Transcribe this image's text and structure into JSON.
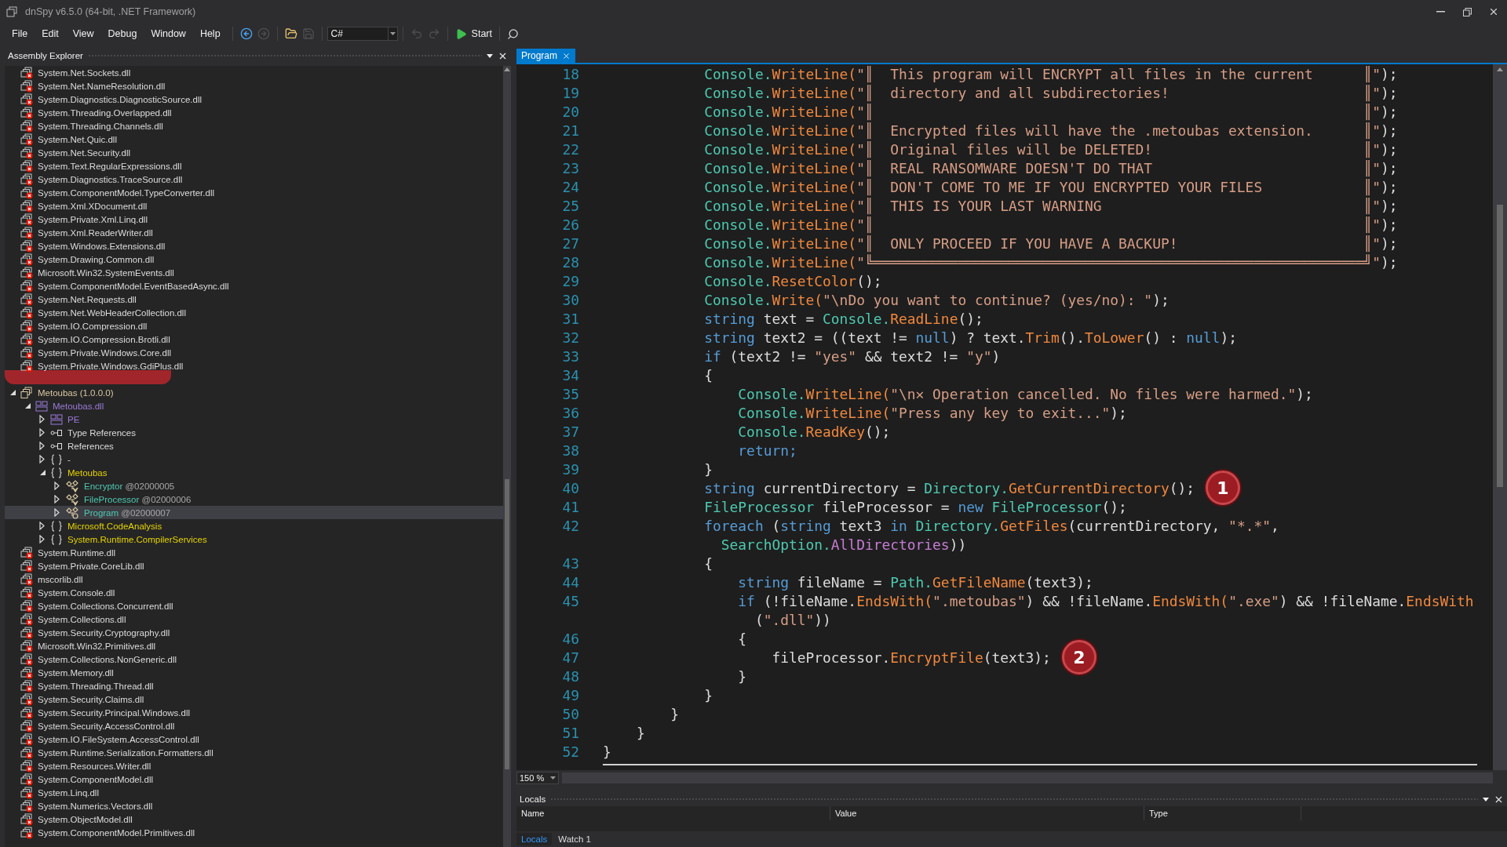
{
  "window": {
    "title": "dnSpy v6.5.0 (64-bit, .NET Framework)"
  },
  "menu": [
    "File",
    "Edit",
    "View",
    "Debug",
    "Window",
    "Help"
  ],
  "toolbar": [
    {
      "kind": "back",
      "disabled": false
    },
    {
      "kind": "forward",
      "disabled": true
    },
    {
      "kind": "open",
      "disabled": false
    },
    {
      "kind": "save",
      "disabled": true
    },
    {
      "kind": "language",
      "value": "C#"
    },
    {
      "kind": "undo",
      "disabled": true
    },
    {
      "kind": "redo",
      "disabled": true
    },
    {
      "kind": "start",
      "label": "Start"
    },
    {
      "kind": "search",
      "disabled": false
    }
  ],
  "assembly_explorer": {
    "title": "Assembly Explorer",
    "items": [
      {
        "label": "System.Net.Sockets.dll",
        "kind": "assembly-error",
        "selected": false
      },
      {
        "label": "System.Net.NameResolution.dll",
        "kind": "assembly-error",
        "selected": false
      },
      {
        "label": "System.Diagnostics.DiagnosticSource.dll",
        "kind": "assembly-error",
        "selected": false
      },
      {
        "label": "System.Threading.Overlapped.dll",
        "kind": "assembly-error",
        "selected": false
      },
      {
        "label": "System.Threading.Channels.dll",
        "kind": "assembly-error",
        "selected": false
      },
      {
        "label": "System.Net.Quic.dll",
        "kind": "assembly-error",
        "selected": false
      },
      {
        "label": "System.Net.Security.dll",
        "kind": "assembly-error",
        "selected": false
      },
      {
        "label": "System.Text.RegularExpressions.dll",
        "kind": "assembly-error",
        "selected": false
      },
      {
        "label": "System.Diagnostics.TraceSource.dll",
        "kind": "assembly-error",
        "selected": false
      },
      {
        "label": "System.ComponentModel.TypeConverter.dll",
        "kind": "assembly-error",
        "selected": false
      },
      {
        "label": "System.Xml.XDocument.dll",
        "kind": "assembly-error",
        "selected": false
      },
      {
        "label": "System.Private.Xml.Linq.dll",
        "kind": "assembly-error",
        "selected": false
      },
      {
        "label": "System.Xml.ReaderWriter.dll",
        "kind": "assembly-error",
        "selected": false
      },
      {
        "label": "System.Windows.Extensions.dll",
        "kind": "assembly-error",
        "selected": false
      },
      {
        "label": "System.Drawing.Common.dll",
        "kind": "assembly-error",
        "selected": false
      },
      {
        "label": "Microsoft.Win32.SystemEvents.dll",
        "kind": "assembly-error",
        "selected": false
      },
      {
        "label": "System.ComponentModel.EventBasedAsync.dll",
        "kind": "assembly-error",
        "selected": false
      },
      {
        "label": "System.Net.Requests.dll",
        "kind": "assembly-error",
        "selected": false
      },
      {
        "label": "System.Net.WebHeaderCollection.dll",
        "kind": "assembly-error",
        "selected": false
      },
      {
        "label": "System.IO.Compression.dll",
        "kind": "assembly-error",
        "selected": false
      },
      {
        "label": "System.IO.Compression.Brotli.dll",
        "kind": "assembly-error",
        "selected": false
      },
      {
        "label": "System.Private.Windows.Core.dll",
        "kind": "assembly-error",
        "selected": false
      },
      {
        "label": "System.Private.Windows.GdiPlus.dll",
        "kind": "assembly-error",
        "selected": false
      },
      {
        "kind": "redaction",
        "selected": false
      },
      {
        "label": "Metoubas (1.0.0.0)",
        "kind": "assembly",
        "expanded": true,
        "selected": false,
        "children": [
          {
            "label": "Metoubas.dll",
            "kind": "module",
            "expanded": true,
            "selected": false,
            "children": [
              {
                "label": "PE",
                "kind": "module",
                "expanded": false,
                "selected": false
              },
              {
                "label": "Type References",
                "kind": "reference",
                "expanded": false,
                "selected": false
              },
              {
                "label": "References",
                "kind": "reference",
                "expanded": false,
                "selected": false
              },
              {
                "label": "-",
                "kind": "namespace-global",
                "expanded": false,
                "selected": false
              },
              {
                "label": "Metoubas",
                "kind": "namespace",
                "expanded": true,
                "selected": false,
                "children": [
                  {
                    "label": "Encryptor",
                    "token": "@02000005",
                    "kind": "class",
                    "expanded": false,
                    "selected": false
                  },
                  {
                    "label": "FileProcessor",
                    "token": "@02000006",
                    "kind": "class",
                    "expanded": false,
                    "selected": false
                  },
                  {
                    "label": "Program",
                    "token": "@02000007",
                    "kind": "static-class",
                    "expanded": false,
                    "selected": true
                  }
                ]
              },
              {
                "label": "Microsoft.CodeAnalysis",
                "kind": "namespace",
                "expanded": false,
                "selected": false
              },
              {
                "label": "System.Runtime.CompilerServices",
                "kind": "namespace",
                "expanded": false,
                "selected": false
              }
            ]
          }
        ]
      },
      {
        "label": "System.Runtime.dll",
        "kind": "assembly-error",
        "selected": false
      },
      {
        "label": "System.Private.CoreLib.dll",
        "kind": "assembly-error",
        "selected": false
      },
      {
        "label": "mscorlib.dll",
        "kind": "assembly-error",
        "selected": false
      },
      {
        "label": "System.Console.dll",
        "kind": "assembly-error",
        "selected": false
      },
      {
        "label": "System.Collections.Concurrent.dll",
        "kind": "assembly-error",
        "selected": false
      },
      {
        "label": "System.Collections.dll",
        "kind": "assembly-error",
        "selected": false
      },
      {
        "label": "System.Security.Cryptography.dll",
        "kind": "assembly-error",
        "selected": false
      },
      {
        "label": "Microsoft.Win32.Primitives.dll",
        "kind": "assembly-error",
        "selected": false
      },
      {
        "label": "System.Collections.NonGeneric.dll",
        "kind": "assembly-error",
        "selected": false
      },
      {
        "label": "System.Memory.dll",
        "kind": "assembly-error",
        "selected": false
      },
      {
        "label": "System.Threading.Thread.dll",
        "kind": "assembly-error",
        "selected": false
      },
      {
        "label": "System.Security.Claims.dll",
        "kind": "assembly-error",
        "selected": false
      },
      {
        "label": "System.Security.Principal.Windows.dll",
        "kind": "assembly-error",
        "selected": false
      },
      {
        "label": "System.Security.AccessControl.dll",
        "kind": "assembly-error",
        "selected": false
      },
      {
        "label": "System.IO.FileSystem.AccessControl.dll",
        "kind": "assembly-error",
        "selected": false
      },
      {
        "label": "System.Runtime.Serialization.Formatters.dll",
        "kind": "assembly-error",
        "selected": false
      },
      {
        "label": "System.Resources.Writer.dll",
        "kind": "assembly-error",
        "selected": false
      },
      {
        "label": "System.ComponentModel.dll",
        "kind": "assembly-error",
        "selected": false
      },
      {
        "label": "System.Linq.dll",
        "kind": "assembly-error",
        "selected": false
      },
      {
        "label": "System.Numerics.Vectors.dll",
        "kind": "assembly-error",
        "selected": false
      },
      {
        "label": "System.ObjectModel.dll",
        "kind": "assembly-error",
        "selected": false
      },
      {
        "label": "System.ComponentModel.Primitives.dll",
        "kind": "assembly-error",
        "selected": false
      }
    ]
  },
  "editor": {
    "tabs": [
      {
        "label": "Program",
        "selected": true
      }
    ],
    "zoom": "150 %",
    "lines": [
      {
        "number": "18",
        "segments": [
          {
            "kind": "type",
            "text": "            Console."
          },
          {
            "kind": "method",
            "text": "WriteLine("
          },
          {
            "kind": "string",
            "text": "\"║  This program will ENCRYPT all files in the current      ║\""
          },
          {
            "kind": "plain",
            "text": ");"
          }
        ]
      },
      {
        "number": "19",
        "segments": [
          {
            "kind": "type",
            "text": "            Console."
          },
          {
            "kind": "method",
            "text": "WriteLine("
          },
          {
            "kind": "string",
            "text": "\"║  directory and all subdirectories!                       ║\""
          },
          {
            "kind": "plain",
            "text": ");"
          }
        ]
      },
      {
        "number": "20",
        "segments": [
          {
            "kind": "type",
            "text": "            Console."
          },
          {
            "kind": "method",
            "text": "WriteLine("
          },
          {
            "kind": "string",
            "text": "\"║                                                          ║\""
          },
          {
            "kind": "plain",
            "text": ");"
          }
        ]
      },
      {
        "number": "21",
        "segments": [
          {
            "kind": "type",
            "text": "            Console."
          },
          {
            "kind": "method",
            "text": "WriteLine("
          },
          {
            "kind": "string",
            "text": "\"║  Encrypted files will have the .metoubas extension.      ║\""
          },
          {
            "kind": "plain",
            "text": ");"
          }
        ]
      },
      {
        "number": "22",
        "segments": [
          {
            "kind": "type",
            "text": "            Console."
          },
          {
            "kind": "method",
            "text": "WriteLine("
          },
          {
            "kind": "string",
            "text": "\"║  Original files will be DELETED!                         ║\""
          },
          {
            "kind": "plain",
            "text": ");"
          }
        ]
      },
      {
        "number": "23",
        "segments": [
          {
            "kind": "type",
            "text": "            Console."
          },
          {
            "kind": "method",
            "text": "WriteLine("
          },
          {
            "kind": "string",
            "text": "\"║  REAL RANSOMWARE DOESN'T DO THAT                         ║\""
          },
          {
            "kind": "plain",
            "text": ");"
          }
        ]
      },
      {
        "number": "24",
        "segments": [
          {
            "kind": "type",
            "text": "            Console."
          },
          {
            "kind": "method",
            "text": "WriteLine("
          },
          {
            "kind": "string",
            "text": "\"║  DON'T COME TO ME IF YOU ENCRYPTED YOUR FILES            ║\""
          },
          {
            "kind": "plain",
            "text": ");"
          }
        ]
      },
      {
        "number": "25",
        "segments": [
          {
            "kind": "type",
            "text": "            Console."
          },
          {
            "kind": "method",
            "text": "WriteLine("
          },
          {
            "kind": "string",
            "text": "\"║  THIS IS YOUR LAST WARNING                               ║\""
          },
          {
            "kind": "plain",
            "text": ");"
          }
        ]
      },
      {
        "number": "26",
        "segments": [
          {
            "kind": "type",
            "text": "            Console."
          },
          {
            "kind": "method",
            "text": "WriteLine("
          },
          {
            "kind": "string",
            "text": "\"║                                                          ║\""
          },
          {
            "kind": "plain",
            "text": ");"
          }
        ]
      },
      {
        "number": "27",
        "segments": [
          {
            "kind": "type",
            "text": "            Console."
          },
          {
            "kind": "method",
            "text": "WriteLine("
          },
          {
            "kind": "string",
            "text": "\"║  ONLY PROCEED IF YOU HAVE A BACKUP!                      ║\""
          },
          {
            "kind": "plain",
            "text": ");"
          }
        ]
      },
      {
        "number": "28",
        "segments": [
          {
            "kind": "type",
            "text": "            Console."
          },
          {
            "kind": "method",
            "text": "WriteLine("
          },
          {
            "kind": "string",
            "text": "\"╚══════════════════════════════════════════════════════════╝\""
          },
          {
            "kind": "plain",
            "text": ");"
          }
        ]
      },
      {
        "number": "29",
        "segments": [
          {
            "kind": "type",
            "text": "            Console."
          },
          {
            "kind": "method",
            "text": "ResetColor"
          },
          {
            "kind": "plain",
            "text": "();"
          }
        ]
      },
      {
        "number": "30",
        "segments": [
          {
            "kind": "type",
            "text": "            Console."
          },
          {
            "kind": "method",
            "text": "Write("
          },
          {
            "kind": "string",
            "text": "\"\\nDo you want to continue? (yes/no): \""
          },
          {
            "kind": "plain",
            "text": ");"
          }
        ]
      },
      {
        "number": "31",
        "segments": [
          {
            "kind": "keyword",
            "text": "            string"
          },
          {
            "kind": "plain",
            "text": " text = "
          },
          {
            "kind": "type",
            "text": "Console."
          },
          {
            "kind": "method",
            "text": "ReadLine"
          },
          {
            "kind": "plain",
            "text": "();"
          }
        ]
      },
      {
        "number": "32",
        "segments": [
          {
            "kind": "keyword",
            "text": "            string"
          },
          {
            "kind": "plain",
            "text": " text2 = ((text != "
          },
          {
            "kind": "keyword",
            "text": "null"
          },
          {
            "kind": "plain",
            "text": ") ? text."
          },
          {
            "kind": "method",
            "text": "Trim"
          },
          {
            "kind": "plain",
            "text": "()."
          },
          {
            "kind": "method",
            "text": "ToLower"
          },
          {
            "kind": "plain",
            "text": "() : "
          },
          {
            "kind": "keyword",
            "text": "null"
          },
          {
            "kind": "plain",
            "text": ");"
          }
        ]
      },
      {
        "number": "33",
        "segments": [
          {
            "kind": "keyword",
            "text": "            if"
          },
          {
            "kind": "plain",
            "text": " (text2 != "
          },
          {
            "kind": "string",
            "text": "\"yes\""
          },
          {
            "kind": "plain",
            "text": " && text2 != "
          },
          {
            "kind": "string",
            "text": "\"y\""
          },
          {
            "kind": "plain",
            "text": ")"
          }
        ]
      },
      {
        "number": "34",
        "segments": [
          {
            "kind": "plain",
            "text": "            {"
          }
        ]
      },
      {
        "number": "35",
        "segments": [
          {
            "kind": "type",
            "text": "                Console."
          },
          {
            "kind": "method",
            "text": "WriteLine("
          },
          {
            "kind": "string",
            "text": "\"\\n✕ Operation cancelled. No files were harmed.\""
          },
          {
            "kind": "plain",
            "text": ");"
          }
        ]
      },
      {
        "number": "36",
        "segments": [
          {
            "kind": "type",
            "text": "                Console."
          },
          {
            "kind": "method",
            "text": "WriteLine("
          },
          {
            "kind": "string",
            "text": "\"Press any key to exit...\""
          },
          {
            "kind": "plain",
            "text": ");"
          }
        ]
      },
      {
        "number": "37",
        "segments": [
          {
            "kind": "type",
            "text": "                Console."
          },
          {
            "kind": "method",
            "text": "ReadKey"
          },
          {
            "kind": "plain",
            "text": "();"
          }
        ]
      },
      {
        "number": "38",
        "segments": [
          {
            "kind": "keyword",
            "text": "                return;"
          }
        ]
      },
      {
        "number": "39",
        "segments": [
          {
            "kind": "plain",
            "text": "            }"
          }
        ]
      },
      {
        "number": "40",
        "badge": "1",
        "segments": [
          {
            "kind": "keyword",
            "text": "            string"
          },
          {
            "kind": "plain",
            "text": " currentDirectory = "
          },
          {
            "kind": "type",
            "text": "Directory."
          },
          {
            "kind": "method",
            "text": "GetCurrentDirectory"
          },
          {
            "kind": "plain",
            "text": "();"
          }
        ]
      },
      {
        "number": "41",
        "segments": [
          {
            "kind": "type",
            "text": "            FileProcessor"
          },
          {
            "kind": "plain",
            "text": " fileProcessor = "
          },
          {
            "kind": "keyword",
            "text": "new"
          },
          {
            "kind": "type",
            "text": " FileProcessor"
          },
          {
            "kind": "plain",
            "text": "();"
          }
        ]
      },
      {
        "number": "42",
        "segments": [
          {
            "kind": "keyword",
            "text": "            foreach"
          },
          {
            "kind": "plain",
            "text": " ("
          },
          {
            "kind": "keyword",
            "text": "string"
          },
          {
            "kind": "plain",
            "text": " text3 "
          },
          {
            "kind": "keyword",
            "text": "in"
          },
          {
            "kind": "type",
            "text": " Directory."
          },
          {
            "kind": "method",
            "text": "GetFiles"
          },
          {
            "kind": "plain",
            "text": "(currentDirectory, "
          },
          {
            "kind": "string",
            "text": "\"*.*\""
          },
          {
            "kind": "plain",
            "text": ","
          }
        ]
      },
      {
        "segments": [
          {
            "kind": "type",
            "text": "              SearchOption."
          },
          {
            "kind": "enum",
            "text": "AllDirectories"
          },
          {
            "kind": "plain",
            "text": "))"
          }
        ]
      },
      {
        "number": "43",
        "segments": [
          {
            "kind": "plain",
            "text": "            {"
          }
        ]
      },
      {
        "number": "44",
        "segments": [
          {
            "kind": "keyword",
            "text": "                string"
          },
          {
            "kind": "plain",
            "text": " fileName = "
          },
          {
            "kind": "type",
            "text": "Path."
          },
          {
            "kind": "method",
            "text": "GetFileName"
          },
          {
            "kind": "plain",
            "text": "(text3);"
          }
        ]
      },
      {
        "number": "45",
        "segments": [
          {
            "kind": "keyword",
            "text": "                if"
          },
          {
            "kind": "plain",
            "text": " (!fileName."
          },
          {
            "kind": "method",
            "text": "EndsWith("
          },
          {
            "kind": "string",
            "text": "\".metoubas\""
          },
          {
            "kind": "plain",
            "text": ") && !fileName."
          },
          {
            "kind": "method",
            "text": "EndsWith("
          },
          {
            "kind": "string",
            "text": "\".exe\""
          },
          {
            "kind": "plain",
            "text": ") && !fileName."
          },
          {
            "kind": "method",
            "text": "EndsWith"
          }
        ]
      },
      {
        "segments": [
          {
            "kind": "plain",
            "text": "                  ("
          },
          {
            "kind": "string",
            "text": "\".dll\""
          },
          {
            "kind": "plain",
            "text": "))"
          }
        ]
      },
      {
        "number": "46",
        "segments": [
          {
            "kind": "plain",
            "text": "                {"
          }
        ]
      },
      {
        "number": "47",
        "badge": "2",
        "segments": [
          {
            "kind": "plain",
            "text": "                    fileProcessor."
          },
          {
            "kind": "method",
            "text": "EncryptFile"
          },
          {
            "kind": "plain",
            "text": "(text3);"
          }
        ]
      },
      {
        "number": "48",
        "segments": [
          {
            "kind": "plain",
            "text": "                }"
          }
        ]
      },
      {
        "number": "49",
        "segments": [
          {
            "kind": "plain",
            "text": "            }"
          }
        ]
      },
      {
        "number": "50",
        "segments": [
          {
            "kind": "plain",
            "text": "        }"
          }
        ]
      },
      {
        "number": "51",
        "segments": [
          {
            "kind": "plain",
            "text": "    }"
          }
        ]
      },
      {
        "number": "52",
        "segments": [
          {
            "kind": "plain",
            "text": "}"
          }
        ]
      }
    ]
  },
  "locals": {
    "title": "Locals",
    "columns": [
      "Name",
      "Value",
      "Type"
    ],
    "tabs": [
      {
        "label": "Locals",
        "selected": true
      },
      {
        "label": "Watch 1",
        "selected": false
      }
    ]
  }
}
